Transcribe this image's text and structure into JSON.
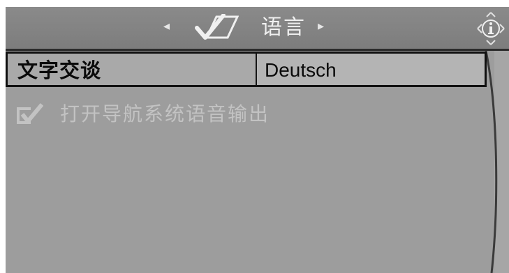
{
  "header": {
    "left_arrow": "◂",
    "right_arrow": "▸",
    "title": "语言",
    "icons": {
      "settings": "settings-check-icon",
      "info": "info-icon"
    }
  },
  "menu": {
    "selected_row": {
      "label": "文字交谈",
      "value": "Deutsch"
    },
    "checkbox_row": {
      "label": "打开导航系统语音输出",
      "checked": true
    }
  },
  "colors": {
    "screen_bg": "#9d9d9d",
    "header_bg": "#828282",
    "selected_border": "#111111",
    "disabled_text": "#c3c3c3"
  }
}
